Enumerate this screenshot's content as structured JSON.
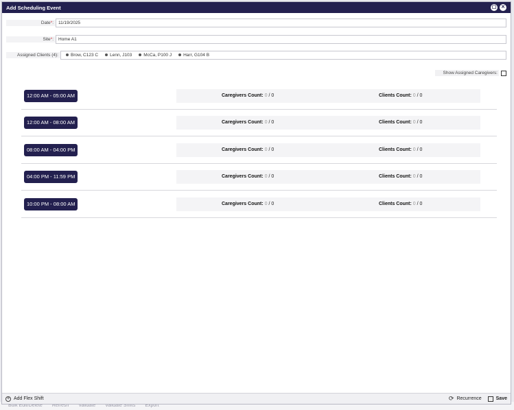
{
  "background": {
    "toolbar": [
      "Bulk Edit/Delete",
      "Refresh",
      "Validate",
      "Validate Shifts",
      "Export"
    ]
  },
  "modal": {
    "title": "Add Scheduling Event"
  },
  "form": {
    "date": {
      "label": "Date",
      "value": "11/19/2025"
    },
    "site": {
      "label": "Site",
      "value": "Home A1"
    },
    "clients": {
      "label": "Assigned Clients (4):",
      "items": [
        "Brow, C123 C",
        "Lenn, J103",
        "McCa, P100 J",
        "Harr, G104 B"
      ]
    }
  },
  "show_caregivers": {
    "label": "Show Assigned Caregivers:",
    "checked": false
  },
  "counts_labels": {
    "caregivers": "Caregivers Count:",
    "clients": "Clients Count:"
  },
  "shifts": [
    {
      "time": "12:00 AM - 05:00 AM",
      "caregivers": "0",
      "caregivers_total": "/ 0",
      "clients": "0",
      "clients_total": "/ 0"
    },
    {
      "time": "12:00 AM - 08:00 AM",
      "caregivers": "0",
      "caregivers_total": "/ 0",
      "clients": "0",
      "clients_total": "/ 0"
    },
    {
      "time": "08:00 AM - 04:00 PM",
      "caregivers": "0",
      "caregivers_total": "/ 0",
      "clients": "0",
      "clients_total": "/ 0"
    },
    {
      "time": "04:00 PM - 11:59 PM",
      "caregivers": "0",
      "caregivers_total": "/ 0",
      "clients": "0",
      "clients_total": "/ 0"
    },
    {
      "time": "10:00 PM - 08:00 AM",
      "caregivers": "0",
      "caregivers_total": "/ 0",
      "clients": "0",
      "clients_total": "/ 0"
    }
  ],
  "footer": {
    "add_flex": "Add Flex Shift",
    "recurrence": "Recurrence",
    "save": "Save"
  },
  "colors": {
    "accent": "#23204f",
    "required": "#d0303a"
  }
}
